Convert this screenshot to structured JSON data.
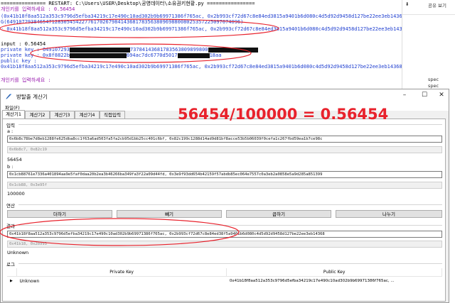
{
  "console": {
    "lines": [
      {
        "parts": [
          {
            "t": "=============== RESTART: C:\\Users\\USER\\Desktop\\공영데이터\\소유권키현황.py ================",
            "c": "blk"
          }
        ]
      },
      {
        "parts": [
          {
            "t": "개인키를 입력하세요 :  0.56454",
            "c": "pur"
          }
        ]
      },
      {
        "parts": [
          {
            "t": "(0x41b18f8aa512a353c9796d5efba34219c17e490c10ad302b9b69971386f765ac, 0x2b993cf72d67c8e84ed3815a9401b6d080c4d5d92d9458d127be22ee3eb14368",
            "c": "blu"
          }
        ]
      },
      {
        "parts": [
          {
            "t": "G(649107293846547128305454227761702679841436817835638096988008025357225097074096)",
            "c": "blu"
          }
        ]
      },
      {
        "parts": [
          {
            "t": ": 0x41b18f8aa512a353c9796d5efba34219c17e490c10ad302b9b69971386f765ac, 0x2b993cf72d67c8e84ed3815a9401b6d080c4d5d92d9458d127be22ee3eb14368",
            "c": "blu"
          }
        ]
      },
      {
        "parts": [
          {
            "t": "",
            "c": "blk"
          }
        ]
      },
      {
        "parts": [
          {
            "t": "input :  0.56454",
            "c": "blk"
          }
        ]
      },
      {
        "parts": [
          {
            "t": "private key :  649107293",
            "c": "blu"
          },
          {
            "redact": 85
          },
          {
            "t": "73784143681783563809899800",
            "c": "blu"
          },
          {
            "redact": 70
          }
        ]
      },
      {
        "parts": [
          {
            "t": "private key :  0x8f8822b",
            "c": "blu"
          },
          {
            "redact": 80
          },
          {
            "t": "694ac7dc6770d5017",
            "c": "blu"
          },
          {
            "redact": 45
          },
          {
            "t": "18aa",
            "c": "blu"
          }
        ]
      },
      {
        "parts": [
          {
            "t": "public key :",
            "c": "blu"
          }
        ]
      },
      {
        "parts": [
          {
            "t": "0x41b18f8aa512a353c9796d5efba34219c17e490c10ad302b9b69971386f765ac, 0x2b993cf72d67c8e84ed3815a9401b6d080c4d5d92d9458d127be22ee3eb14368",
            "c": "blu"
          }
        ]
      },
      {
        "parts": [
          {
            "t": "",
            "c": "blk"
          }
        ]
      },
      {
        "parts": [
          {
            "t": "개인키를 입력하세요 :",
            "c": "pur"
          }
        ]
      }
    ]
  },
  "explorer": {
    "button_label": "⬇",
    "button2_label": "공유 보기",
    "items": [
      "spec",
      "spec"
    ]
  },
  "window": {
    "title": "방탈출 계산기",
    "menu": "파일(F)",
    "tabs": [
      "계산기1",
      "계산기2",
      "계산기3",
      "계산기4",
      "직접입력"
    ],
    "minimize": "–",
    "maximize": "☐",
    "close": "✕"
  },
  "input_group": {
    "title": "입력",
    "a_label": "a :",
    "a_value": "0x6b8c78be7d8eb1288fe625dba8cc1f63a6ad503fa5fa2cb95d1bb25cc401c6bf, 0x82c199c1288d14ad9d81bf8acce53b5b06039f0cefa1c267fbd59ea1b7ce98c",
    "a_readonly": "0x6b8c7, 0x82c19",
    "a_number": "56454",
    "b_label": "b :",
    "b_value": "0x1cb88761e7336a401894aa9e5faf0daa20b2ea3b46266ba349fa3f22a09d44fd, 0x3e9f93dd654b42159f57abdb85ec064e7557c0a3eb2a0858e5a9d285a851399",
    "b_readonly": "0x1cb88, 0x3e95f",
    "b_number": "100000"
  },
  "ops_group": {
    "title": "연산",
    "buttons": [
      "더하기",
      "빼기",
      "곱하기",
      "나누기"
    ]
  },
  "result_group": {
    "title": "결과",
    "value": "0x41b18f8aa512a353c9796d5efba34219c17e490c10ad302b9b69971386f765ac, 0x2b993cf72d67c8e84ed38f5a9401b6d080c4d5d92d9458d127be22ee3eb14368",
    "readonly": "0x41b18, 0x2b993",
    "status": "Unknown"
  },
  "log_group": {
    "title": "로그",
    "columns": [
      "Private Key",
      "Public Key"
    ],
    "rows": [
      {
        "private": "Unknown",
        "public": "0x41b18f8aa512a353c9796d5efba34219c17e490c10ad302b9b69971386f765ac, ..."
      }
    ]
  },
  "annotation": {
    "ratio_text": "56454/100000  =  0.56454",
    "color": "#e8222c"
  }
}
